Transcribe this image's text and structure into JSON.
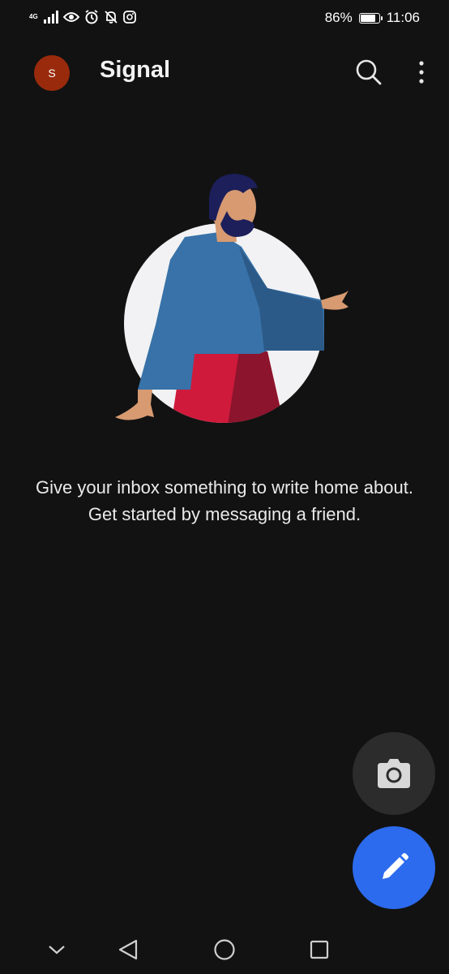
{
  "status_bar": {
    "network_label": "4G",
    "battery_text": "86%",
    "battery_level": 0.86,
    "time": "11:06",
    "icons": [
      "signal-icon",
      "eye-icon",
      "alarm-icon",
      "notifications-off-icon",
      "instagram-icon"
    ]
  },
  "app_bar": {
    "avatar_initial": "S",
    "avatar_color": "#9a2a0c",
    "title": "Signal",
    "icons": [
      "search-icon",
      "more-vert-icon"
    ]
  },
  "empty_state": {
    "message": "Give your inbox something to write home about. Get started by messaging a friend."
  },
  "fabs": {
    "camera_icon": "camera-icon",
    "compose_icon": "pencil-icon",
    "compose_color": "#2c6bed"
  },
  "nav_bar": {
    "icons": [
      "chevron-down-icon",
      "back-icon",
      "home-icon",
      "recents-icon"
    ]
  }
}
